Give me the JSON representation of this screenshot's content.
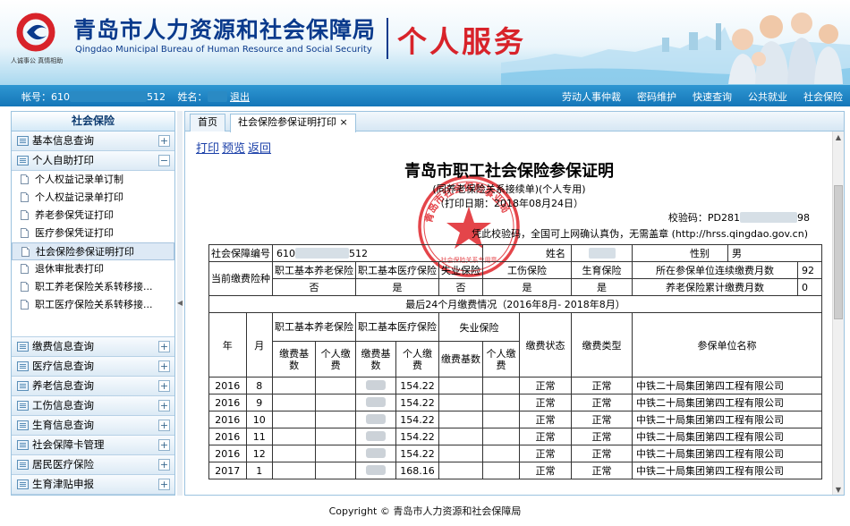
{
  "header": {
    "org_name": "青岛市人力资源和社会保障局",
    "org_name_en": "Qingdao Municipal Bureau of Human Resource and Social Security",
    "slogan": "人诚事公 真情相助",
    "service_title": "个人服务"
  },
  "nav": {
    "account_label": "帐号：",
    "account_prefix": "610",
    "account_suffix": "512",
    "name_label": "姓名：",
    "logout": "退出",
    "links": [
      "劳动人事仲裁",
      "密码维护",
      "快速查询",
      "公共就业",
      "社会保险"
    ]
  },
  "sidebar": {
    "title": "社会保险",
    "groups_top": [
      {
        "label": "基本信息查询",
        "toggle": "+"
      },
      {
        "label": "个人自助打印",
        "toggle": "−"
      }
    ],
    "items": [
      {
        "label": "个人权益记录单订制"
      },
      {
        "label": "个人权益记录单打印"
      },
      {
        "label": "养老参保凭证打印"
      },
      {
        "label": "医疗参保凭证打印"
      },
      {
        "label": "社会保险参保证明打印"
      },
      {
        "label": "退休审批表打印"
      },
      {
        "label": "职工养老保险关系转移接..."
      },
      {
        "label": "职工医疗保险关系转移接..."
      }
    ],
    "groups_bottom": [
      {
        "label": "缴费信息查询",
        "toggle": "+"
      },
      {
        "label": "医疗信息查询",
        "toggle": "+"
      },
      {
        "label": "养老信息查询",
        "toggle": "+"
      },
      {
        "label": "工伤信息查询",
        "toggle": "+"
      },
      {
        "label": "生育信息查询",
        "toggle": "+"
      },
      {
        "label": "社会保障卡管理",
        "toggle": "+"
      },
      {
        "label": "居民医疗保险",
        "toggle": "+"
      },
      {
        "label": "生育津贴申报",
        "toggle": "+"
      }
    ]
  },
  "tabs": {
    "home": "首页",
    "cert": "社会保险参保证明打印",
    "close": "×"
  },
  "doc": {
    "actions": [
      "打印",
      "预览",
      "返回"
    ],
    "title": "青岛市职工社会保险参保证明",
    "subtitle": "(同养老保险关系接续单)(个人专用)",
    "print_date": "（打印日期：2018年08月24日）",
    "verify_code_label": "校验码：",
    "verify_code_prefix": "PD281",
    "verify_code_suffix": "98",
    "verify_note": "凭此校验码，全国可上网确认真伪，无需盖章 (http://hrss.qingdao.gov.cn)",
    "stamp_text": "青岛市社会保险事业局",
    "stamp_sub": "社会保险关系专用章",
    "info": {
      "sb_no_label": "社会保障编号",
      "sb_no_prefix": "610",
      "sb_no_suffix": "512",
      "name_label": "姓名",
      "gender_label": "性别",
      "gender": "男"
    },
    "status": {
      "label": "当前缴费险种",
      "cols": [
        "职工基本养老保险",
        "职工基本医疗保险",
        "失业保险",
        "工伤保险",
        "生育保险"
      ],
      "vals": [
        "否",
        "是",
        "否",
        "是",
        "是"
      ],
      "months_label": "所在参保单位连续缴费月数",
      "months": "92",
      "pension_label": "养老保险累计缴费月数",
      "pension": "0"
    },
    "history": {
      "title": "最后24个月缴费情况（2016年8月- 2018年8月）",
      "h_year": "年",
      "h_month": "月",
      "h_pension": "职工基本养老保险",
      "h_medical": "职工基本医疗保险",
      "h_unemp": "失业保险",
      "h_base": "缴费基数",
      "h_personal": "个人缴费",
      "h_status": "缴费状态",
      "h_type": "缴费类型",
      "h_unit": "参保单位名称",
      "rows": [
        {
          "year": "2016",
          "month": "8",
          "med_personal": "154.22",
          "status": "正常",
          "type": "正常",
          "unit": "中铁二十局集团第四工程有限公司"
        },
        {
          "year": "2016",
          "month": "9",
          "med_personal": "154.22",
          "status": "正常",
          "type": "正常",
          "unit": "中铁二十局集团第四工程有限公司"
        },
        {
          "year": "2016",
          "month": "10",
          "med_personal": "154.22",
          "status": "正常",
          "type": "正常",
          "unit": "中铁二十局集团第四工程有限公司"
        },
        {
          "year": "2016",
          "month": "11",
          "med_personal": "154.22",
          "status": "正常",
          "type": "正常",
          "unit": "中铁二十局集团第四工程有限公司"
        },
        {
          "year": "2016",
          "month": "12",
          "med_personal": "154.22",
          "status": "正常",
          "type": "正常",
          "unit": "中铁二十局集团第四工程有限公司"
        },
        {
          "year": "2017",
          "month": "1",
          "med_personal": "168.16",
          "status": "正常",
          "type": "正常",
          "unit": "中铁二十局集团第四工程有限公司"
        }
      ]
    }
  },
  "footer": "Copyright © 青岛市人力资源和社会保障局"
}
